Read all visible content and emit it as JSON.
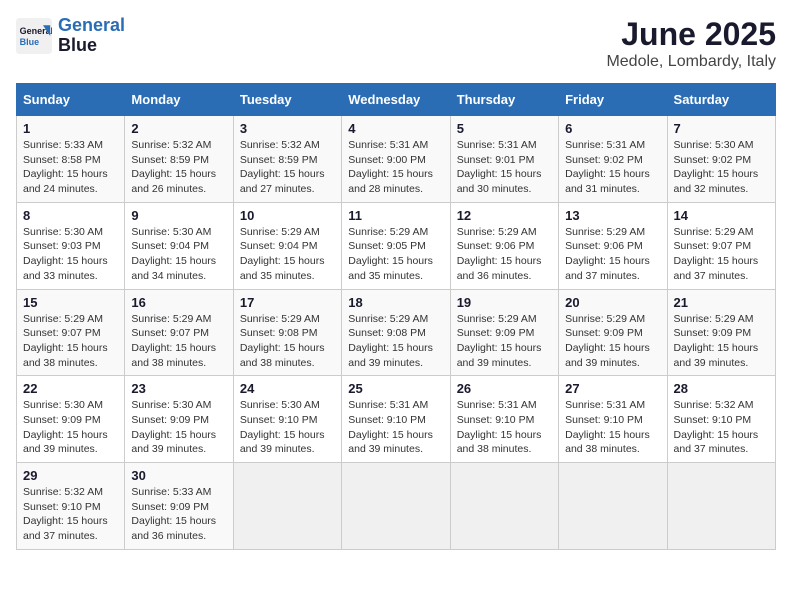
{
  "logo": {
    "line1": "General",
    "line2": "Blue"
  },
  "title": "June 2025",
  "location": "Medole, Lombardy, Italy",
  "weekdays": [
    "Sunday",
    "Monday",
    "Tuesday",
    "Wednesday",
    "Thursday",
    "Friday",
    "Saturday"
  ],
  "rows": [
    [
      null,
      null,
      {
        "day": "1",
        "sunrise": "5:33 AM",
        "sunset": "8:58 PM",
        "daylight": "15 hours and 24 minutes."
      },
      {
        "day": "2",
        "sunrise": "5:32 AM",
        "sunset": "8:59 PM",
        "daylight": "15 hours and 26 minutes."
      },
      {
        "day": "3",
        "sunrise": "5:32 AM",
        "sunset": "8:59 PM",
        "daylight": "15 hours and 27 minutes."
      },
      {
        "day": "4",
        "sunrise": "5:31 AM",
        "sunset": "9:00 PM",
        "daylight": "15 hours and 28 minutes."
      },
      {
        "day": "5",
        "sunrise": "5:31 AM",
        "sunset": "9:01 PM",
        "daylight": "15 hours and 30 minutes."
      },
      {
        "day": "6",
        "sunrise": "5:31 AM",
        "sunset": "9:02 PM",
        "daylight": "15 hours and 31 minutes."
      },
      {
        "day": "7",
        "sunrise": "5:30 AM",
        "sunset": "9:02 PM",
        "daylight": "15 hours and 32 minutes."
      }
    ],
    [
      {
        "day": "8",
        "sunrise": "5:30 AM",
        "sunset": "9:03 PM",
        "daylight": "15 hours and 33 minutes."
      },
      {
        "day": "9",
        "sunrise": "5:30 AM",
        "sunset": "9:04 PM",
        "daylight": "15 hours and 34 minutes."
      },
      {
        "day": "10",
        "sunrise": "5:29 AM",
        "sunset": "9:04 PM",
        "daylight": "15 hours and 35 minutes."
      },
      {
        "day": "11",
        "sunrise": "5:29 AM",
        "sunset": "9:05 PM",
        "daylight": "15 hours and 35 minutes."
      },
      {
        "day": "12",
        "sunrise": "5:29 AM",
        "sunset": "9:06 PM",
        "daylight": "15 hours and 36 minutes."
      },
      {
        "day": "13",
        "sunrise": "5:29 AM",
        "sunset": "9:06 PM",
        "daylight": "15 hours and 37 minutes."
      },
      {
        "day": "14",
        "sunrise": "5:29 AM",
        "sunset": "9:07 PM",
        "daylight": "15 hours and 37 minutes."
      }
    ],
    [
      {
        "day": "15",
        "sunrise": "5:29 AM",
        "sunset": "9:07 PM",
        "daylight": "15 hours and 38 minutes."
      },
      {
        "day": "16",
        "sunrise": "5:29 AM",
        "sunset": "9:07 PM",
        "daylight": "15 hours and 38 minutes."
      },
      {
        "day": "17",
        "sunrise": "5:29 AM",
        "sunset": "9:08 PM",
        "daylight": "15 hours and 38 minutes."
      },
      {
        "day": "18",
        "sunrise": "5:29 AM",
        "sunset": "9:08 PM",
        "daylight": "15 hours and 39 minutes."
      },
      {
        "day": "19",
        "sunrise": "5:29 AM",
        "sunset": "9:09 PM",
        "daylight": "15 hours and 39 minutes."
      },
      {
        "day": "20",
        "sunrise": "5:29 AM",
        "sunset": "9:09 PM",
        "daylight": "15 hours and 39 minutes."
      },
      {
        "day": "21",
        "sunrise": "5:29 AM",
        "sunset": "9:09 PM",
        "daylight": "15 hours and 39 minutes."
      }
    ],
    [
      {
        "day": "22",
        "sunrise": "5:30 AM",
        "sunset": "9:09 PM",
        "daylight": "15 hours and 39 minutes."
      },
      {
        "day": "23",
        "sunrise": "5:30 AM",
        "sunset": "9:09 PM",
        "daylight": "15 hours and 39 minutes."
      },
      {
        "day": "24",
        "sunrise": "5:30 AM",
        "sunset": "9:10 PM",
        "daylight": "15 hours and 39 minutes."
      },
      {
        "day": "25",
        "sunrise": "5:31 AM",
        "sunset": "9:10 PM",
        "daylight": "15 hours and 39 minutes."
      },
      {
        "day": "26",
        "sunrise": "5:31 AM",
        "sunset": "9:10 PM",
        "daylight": "15 hours and 38 minutes."
      },
      {
        "day": "27",
        "sunrise": "5:31 AM",
        "sunset": "9:10 PM",
        "daylight": "15 hours and 38 minutes."
      },
      {
        "day": "28",
        "sunrise": "5:32 AM",
        "sunset": "9:10 PM",
        "daylight": "15 hours and 37 minutes."
      }
    ],
    [
      {
        "day": "29",
        "sunrise": "5:32 AM",
        "sunset": "9:10 PM",
        "daylight": "15 hours and 37 minutes."
      },
      {
        "day": "30",
        "sunrise": "5:33 AM",
        "sunset": "9:09 PM",
        "daylight": "15 hours and 36 minutes."
      },
      null,
      null,
      null,
      null,
      null
    ]
  ]
}
